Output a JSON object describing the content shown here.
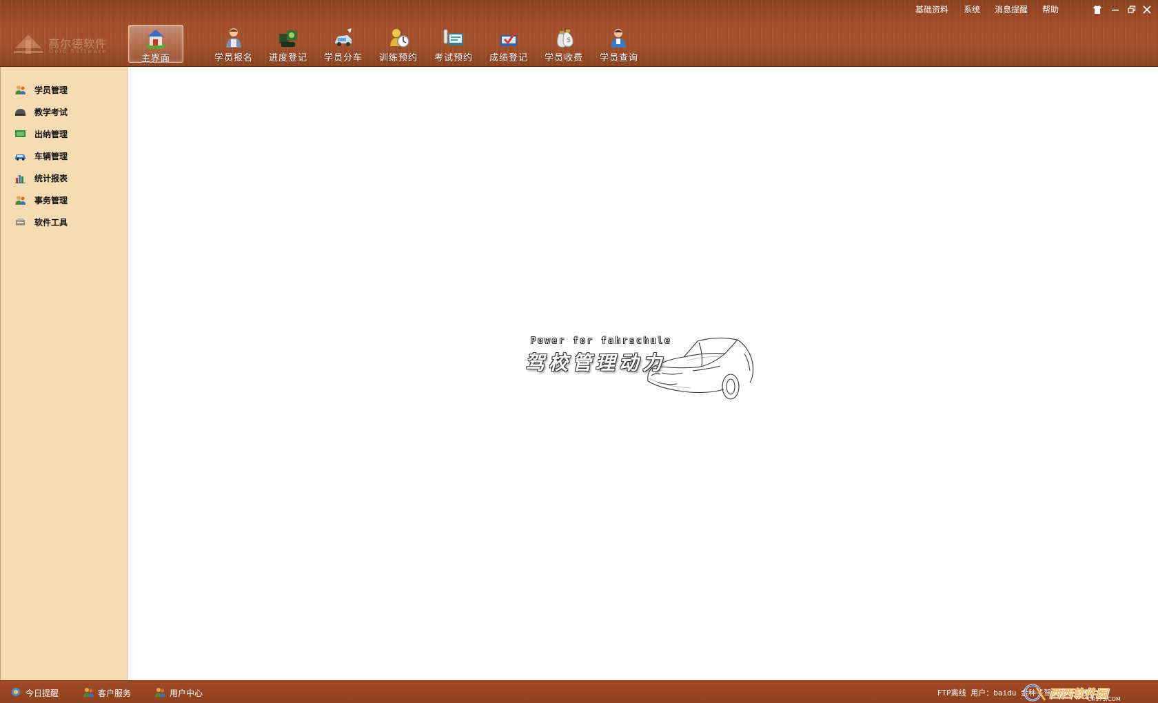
{
  "logo": {
    "title": "高尔德软件",
    "subtitle": "Gold Software"
  },
  "toolbar": {
    "main_tab": "主界面",
    "items": [
      {
        "label": "学员报名",
        "icon": "person-register-icon"
      },
      {
        "label": "进度登记",
        "icon": "progress-icon"
      },
      {
        "label": "学员分车",
        "icon": "car-assign-icon"
      },
      {
        "label": "训练预约",
        "icon": "clock-icon"
      },
      {
        "label": "考试预约",
        "icon": "exam-icon"
      },
      {
        "label": "成绩登记",
        "icon": "grade-icon"
      },
      {
        "label": "学员收费",
        "icon": "money-bag-icon"
      },
      {
        "label": "学员查询",
        "icon": "person-search-icon"
      }
    ]
  },
  "top_menu": {
    "basic": "基础资料",
    "system": "系统",
    "messages": "消息提醒",
    "help": "帮助"
  },
  "sidebar": {
    "items": [
      {
        "label": "学员管理",
        "icon": "students-icon"
      },
      {
        "label": "教学考试",
        "icon": "teaching-icon"
      },
      {
        "label": "出纳管理",
        "icon": "cash-icon"
      },
      {
        "label": "车辆管理",
        "icon": "vehicle-icon"
      },
      {
        "label": "统计报表",
        "icon": "chart-icon"
      },
      {
        "label": "事务管理",
        "icon": "affairs-icon"
      },
      {
        "label": "软件工具",
        "icon": "tools-icon"
      }
    ]
  },
  "splash": {
    "tagline_en": "Power for fahrschule",
    "tagline_zh": "驾校管理动力"
  },
  "statusbar": {
    "today": "今日提醒",
    "service": "客户服务",
    "user_center": "用户中心",
    "right_text": "FTP离线 用户：baidu 金种子驾校管理系统"
  },
  "watermark": {
    "text": "西西软件园",
    "url": "CR173.COM"
  },
  "colors": {
    "wood": "#a24d28",
    "sidebar": "#f5dcb2",
    "content": "#ffffff"
  }
}
